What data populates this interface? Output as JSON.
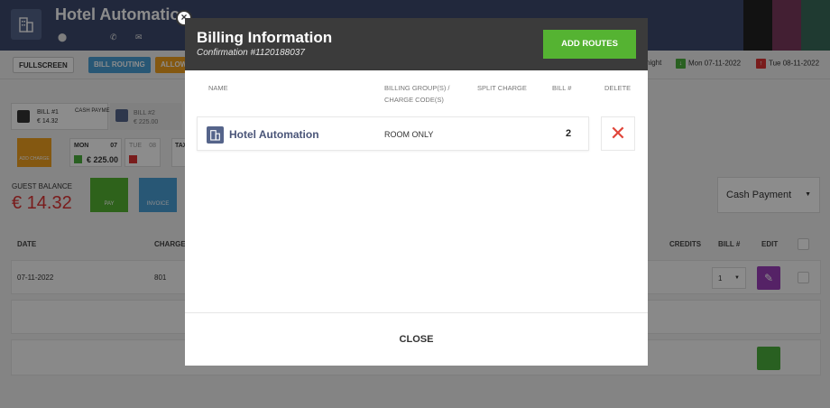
{
  "header": {
    "hotel_name": "Hotel Automation"
  },
  "toolbar": {
    "fullscreen": "FULLSCREEN",
    "bill_routing": "BILL ROUTING",
    "allow": "ALLOW",
    "nights_suffix": "night",
    "arrival": "Mon 07-11-2022",
    "departure": "Tue 08-11-2022"
  },
  "bills": [
    {
      "label": "BILL #1",
      "amount": "€ 14.32",
      "type": "CASH PAYMENT"
    },
    {
      "label": "BILL #2",
      "amount": "€ 225.00"
    }
  ],
  "days": [
    {
      "day": "MON",
      "num": "07",
      "amount": "€ 225.00"
    },
    {
      "day": "TUE",
      "num": "08"
    },
    {
      "day": "TAX"
    }
  ],
  "add_charge_label": "ADD CHARGE",
  "guest_balance": {
    "label": "GUEST BALANCE",
    "value": "€ 14.32"
  },
  "actions": {
    "pay": "PAY",
    "invoice": "INVOICE"
  },
  "payment_method": "Cash Payment",
  "table": {
    "headers": {
      "date": "DATE",
      "charge": "CHARGE",
      "credits": "CREDITS",
      "bill": "BILL #",
      "edit": "EDIT"
    },
    "rows": [
      {
        "date": "07-11-2022",
        "charge": "801",
        "bill": "1"
      }
    ]
  },
  "modal": {
    "title": "Billing Information",
    "subtitle": "Confirmation #1120188037",
    "add_routes": "ADD ROUTES",
    "columns": {
      "name": "NAME",
      "billing_group": "BILLING GROUP(S) /",
      "charge_codes": "CHARGE CODE(S)",
      "split_charge": "SPLIT CHARGE",
      "bill_no": "BILL #",
      "delete": "DELETE"
    },
    "routes": [
      {
        "name": "Hotel Automation",
        "group": "ROOM ONLY",
        "bill": "2"
      }
    ],
    "close": "CLOSE"
  },
  "colors": {
    "header": "#3c4a6e",
    "modal_header": "#3b3b3b",
    "primary_green": "#55b332",
    "delete_red": "#e0453a"
  }
}
